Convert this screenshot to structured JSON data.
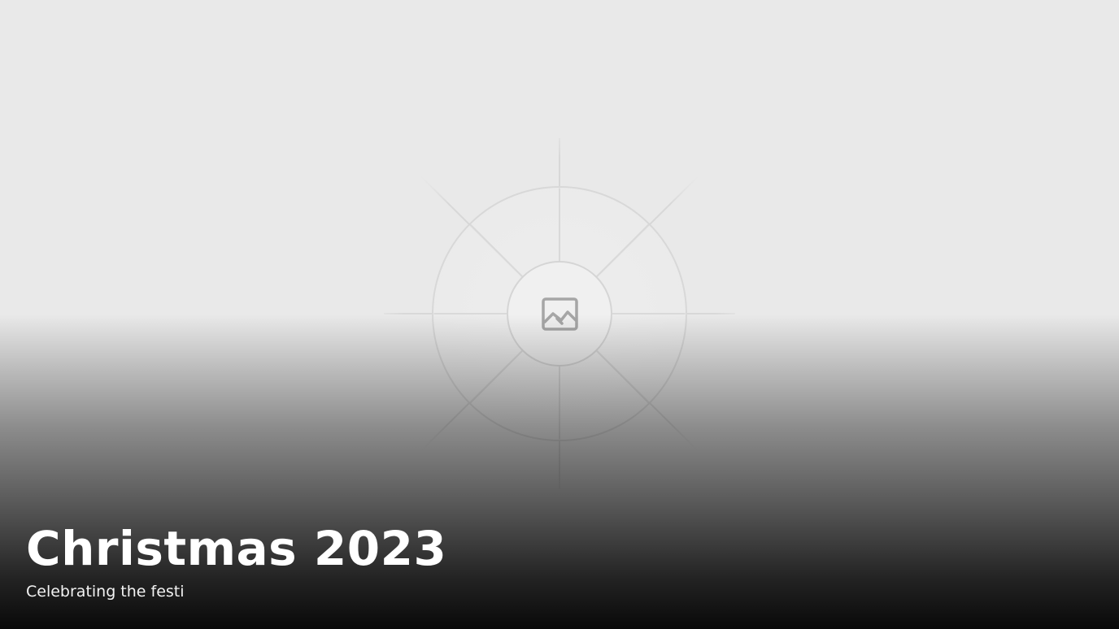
{
  "hero": {
    "title": "Christmas 2023",
    "subtitle": "Celebrating the festi",
    "image_placeholder_icon": "image-icon"
  },
  "colors": {
    "background": "#e9e9e9",
    "placeholder_lines": "#d6d6d6",
    "icon_color": "#a6a6a6",
    "title_text": "#ffffff"
  }
}
